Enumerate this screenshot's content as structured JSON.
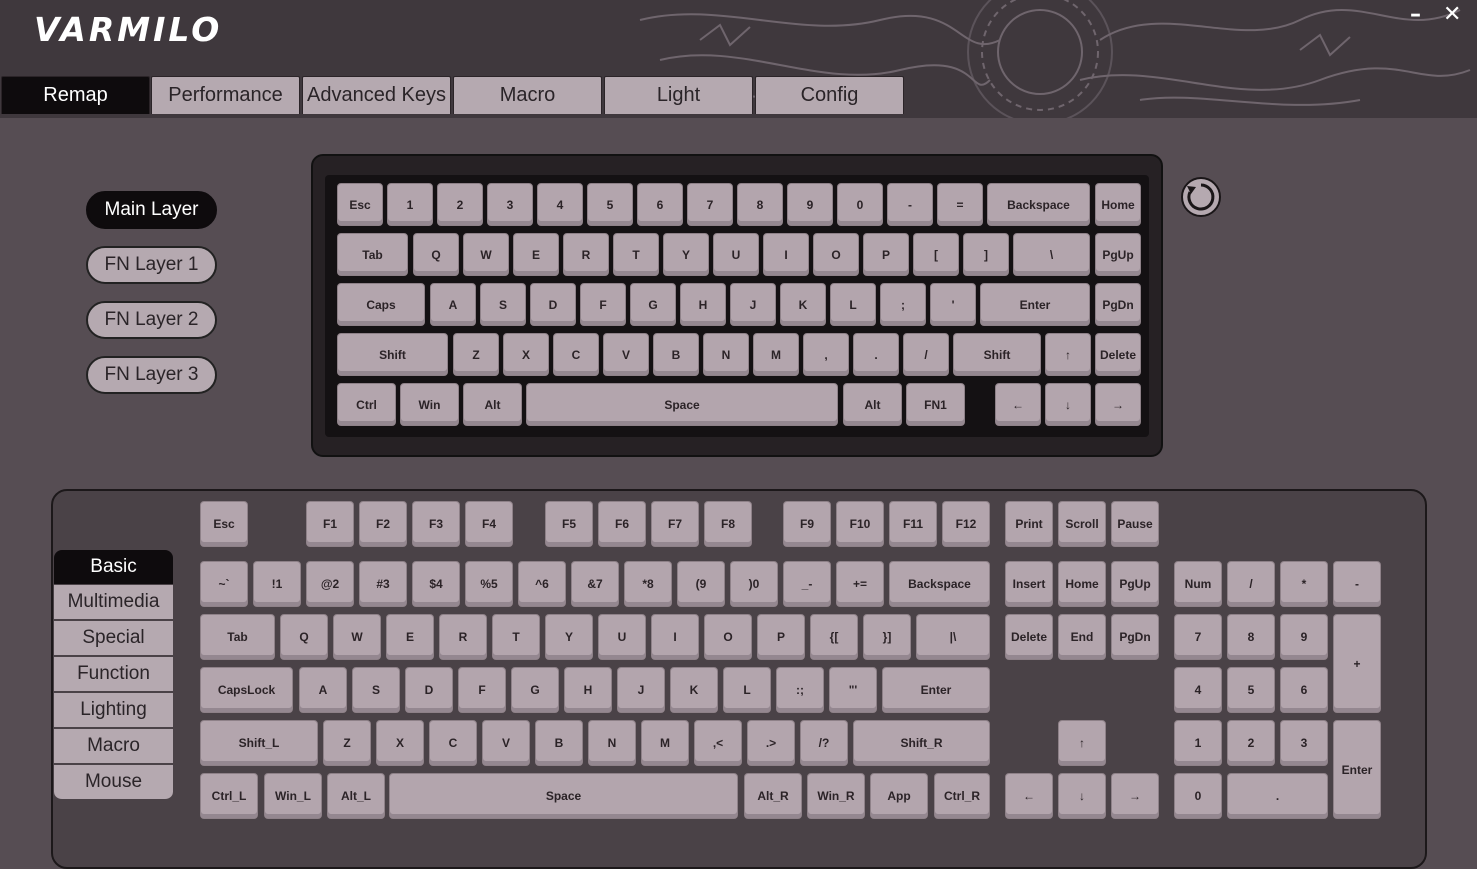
{
  "app": {
    "logo": "VARMILO",
    "minimize": "–",
    "close": "✕"
  },
  "tabs": [
    "Remap",
    "Performance",
    "Advanced Keys",
    "Macro",
    "Light",
    "Config"
  ],
  "active_tab": "Remap",
  "layers": [
    "Main Layer",
    "FN Layer 1",
    "FN Layer 2",
    "FN Layer 3"
  ],
  "active_layer": "Main Layer",
  "keyboard_rows": [
    [
      "Esc",
      "1",
      "2",
      "3",
      "4",
      "5",
      "6",
      "7",
      "8",
      "9",
      "0",
      "-",
      "=",
      "Backspace",
      "Home"
    ],
    [
      "Tab",
      "Q",
      "W",
      "E",
      "R",
      "T",
      "Y",
      "U",
      "I",
      "O",
      "P",
      "[",
      "]",
      "\\",
      "PgUp"
    ],
    [
      "Caps",
      "A",
      "S",
      "D",
      "F",
      "G",
      "H",
      "J",
      "K",
      "L",
      ";",
      "'",
      "Enter",
      "PgDn"
    ],
    [
      "Shift",
      "Z",
      "X",
      "C",
      "V",
      "B",
      "N",
      "M",
      ",",
      ".",
      "/",
      "Shift",
      "↑",
      "Delete"
    ],
    [
      "Ctrl",
      "Win",
      "Alt",
      "Space",
      "Alt",
      "FN1",
      "←",
      "↓",
      "→"
    ]
  ],
  "categories": [
    "Basic",
    "Multimedia",
    "Special",
    "Function",
    "Lighting",
    "Macro",
    "Mouse"
  ],
  "active_category": "Basic",
  "picker_rows": [
    [
      "Esc",
      "F1",
      "F2",
      "F3",
      "F4",
      "F5",
      "F6",
      "F7",
      "F8",
      "F9",
      "F10",
      "F11",
      "F12",
      "Print",
      "Scroll",
      "Pause"
    ],
    [
      "~`",
      "!1",
      "@2",
      "#3",
      "$4",
      "%5",
      "^6",
      "&7",
      "*8",
      "(9",
      ")0",
      "_-",
      "+=",
      "Backspace",
      "Insert",
      "Home",
      "PgUp",
      "Num",
      "/",
      "*",
      "-"
    ],
    [
      "Tab",
      "Q",
      "W",
      "E",
      "R",
      "T",
      "Y",
      "U",
      "I",
      "O",
      "P",
      "{[",
      "}]",
      "|\\",
      "Delete",
      "End",
      "PgDn",
      "7",
      "8",
      "9",
      "+"
    ],
    [
      "CapsLock",
      "A",
      "S",
      "D",
      "F",
      "G",
      "H",
      "J",
      "K",
      "L",
      ":;",
      "\"'",
      "Enter",
      "4",
      "5",
      "6"
    ],
    [
      "Shift_L",
      "Z",
      "X",
      "C",
      "V",
      "B",
      "N",
      "M",
      ",<",
      ".>",
      "/?",
      "Shift_R",
      "↑",
      "1",
      "2",
      "3",
      "Enter"
    ],
    [
      "Ctrl_L",
      "Win_L",
      "Alt_L",
      "Space",
      "Alt_R",
      "Win_R",
      "App",
      "Ctrl_R",
      "←",
      "↓",
      "→",
      "0",
      "."
    ]
  ],
  "colors": {
    "keycap": "#b3a5ad",
    "active": "#0e0b0d",
    "background": "#564d53"
  }
}
